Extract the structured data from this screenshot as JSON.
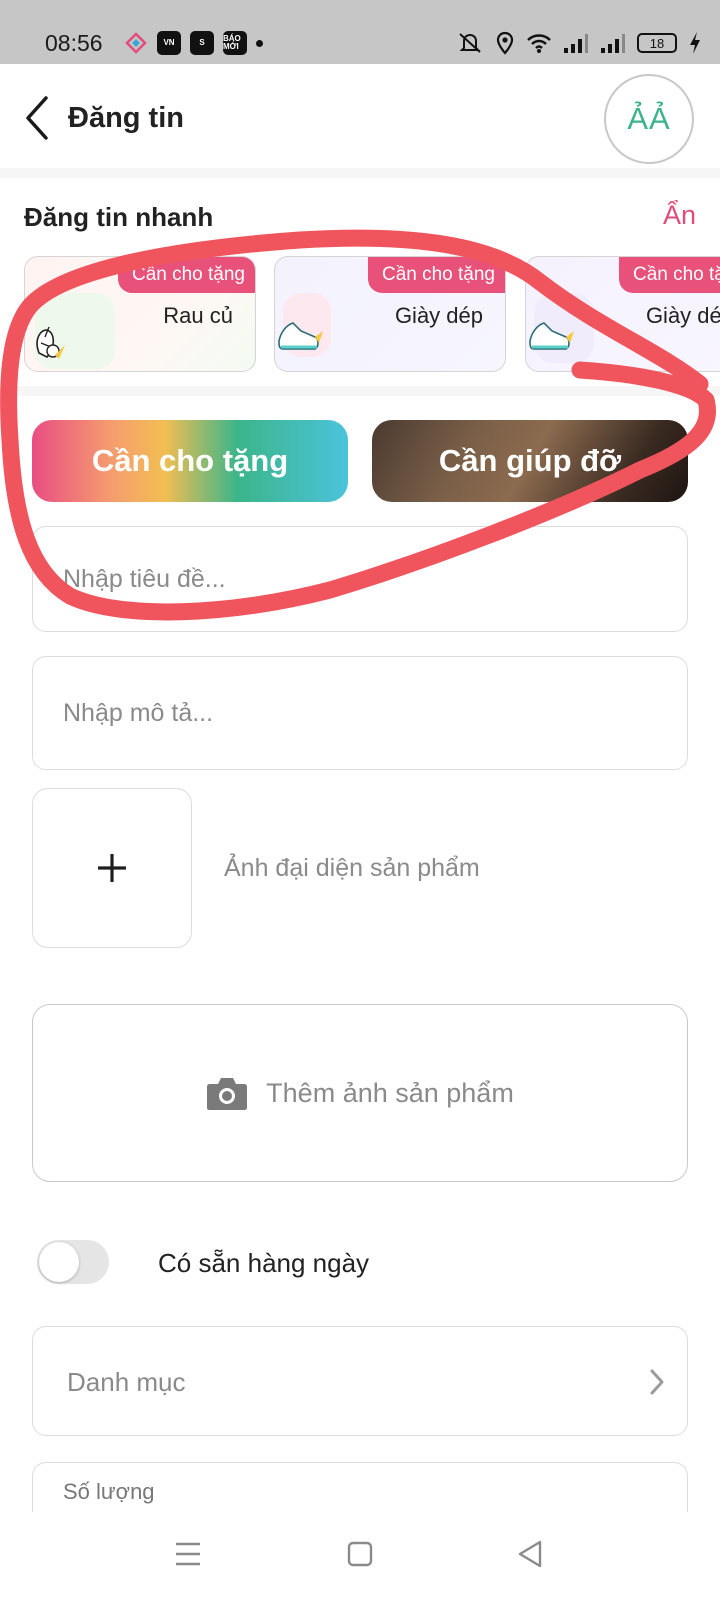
{
  "status_bar": {
    "time": "08:56",
    "app_icons": [
      "VN",
      "S",
      "BÁO MỚI"
    ],
    "battery": "18"
  },
  "header": {
    "title": "Đăng tin",
    "font_button": "ẢẢ"
  },
  "quick_post": {
    "title": "Đăng tin nhanh",
    "hide_label": "Ẩn",
    "cards": [
      {
        "badge": "Cần cho tặng",
        "label": "Rau củ"
      },
      {
        "badge": "Cần cho tặng",
        "label": "Giày dép"
      },
      {
        "badge": "Cần cho tặng",
        "label": "Giày dép"
      }
    ]
  },
  "post_type": {
    "give_label": "Cần cho tặng",
    "help_label": "Cần giúp đỡ"
  },
  "form": {
    "title_placeholder": "Nhập tiêu đề...",
    "description_placeholder": "Nhập mô tả...",
    "avatar_label": "Ảnh đại diện sản phẩm",
    "add_photos_label": "Thêm ảnh sản phẩm",
    "daily_available_label": "Có sẵn hàng ngày",
    "daily_available_on": false,
    "category_placeholder": "Danh mục",
    "quantity_label": "Số lượng"
  },
  "colors": {
    "accent_pink": "#e8527a",
    "accent_green": "#3cb38a",
    "annotation_red": "#f0545c"
  }
}
